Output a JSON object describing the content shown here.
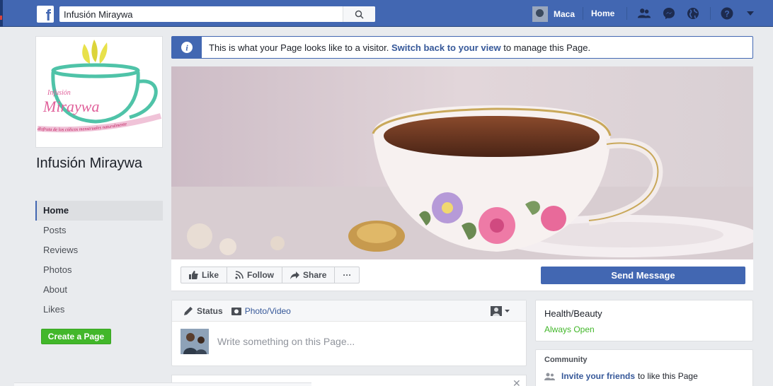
{
  "topbar": {
    "logo": "f",
    "search_value": "Infusión Miraywa",
    "user_name": "Maca",
    "home_label": "Home",
    "icons": [
      "friends-icon",
      "messenger-icon",
      "globe-icon",
      "help-icon",
      "caret-down-icon"
    ]
  },
  "page": {
    "name": "Infusión Miraywa",
    "logo_text": {
      "line1": "Infusión",
      "line2": "Miraywa",
      "tagline": "disfruta de los cólicos menstruales naturalmente"
    }
  },
  "left_nav": {
    "items": [
      {
        "label": "Home",
        "active": true
      },
      {
        "label": "Posts"
      },
      {
        "label": "Reviews"
      },
      {
        "label": "Photos"
      },
      {
        "label": "About"
      },
      {
        "label": "Likes"
      }
    ],
    "create_page_label": "Create a Page"
  },
  "banner": {
    "prefix": "This is what your Page looks like to a visitor.",
    "link": "Switch back to your view",
    "suffix": "to manage this Page."
  },
  "actions": {
    "like": "Like",
    "follow": "Follow",
    "share": "Share",
    "more": "···",
    "send_message": "Send Message"
  },
  "composer": {
    "status_tab": "Status",
    "photo_tab": "Photo/Video",
    "placeholder": "Write something on this Page..."
  },
  "info": {
    "category": "Health/Beauty",
    "hours": "Always Open"
  },
  "community": {
    "title": "Community",
    "invite_link": "Invite your friends",
    "invite_suffix": "to like this Page"
  },
  "colors": {
    "brand_blue": "#4267b2",
    "green": "#42b72a",
    "logo_teal": "#4fc3a8",
    "logo_pink": "#e0609a"
  }
}
